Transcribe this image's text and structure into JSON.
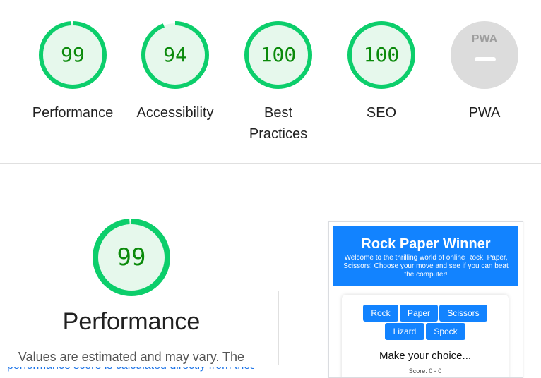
{
  "categories": [
    {
      "score": "99",
      "label": "Performance",
      "value": 99,
      "color": "#0cce6b"
    },
    {
      "score": "94",
      "label": "Accessibility",
      "value": 94,
      "color": "#0cce6b"
    },
    {
      "score": "100",
      "label": "Best Practices",
      "value": 100,
      "color": "#0cce6b"
    },
    {
      "score": "100",
      "label": "SEO",
      "value": 100,
      "color": "#0cce6b"
    },
    {
      "score": "PWA",
      "label": "PWA",
      "value": null,
      "color": "#dcdcdc"
    }
  ],
  "performance": {
    "score": "99",
    "value": 99,
    "title": "Performance",
    "description": "Values are estimated and may vary. The",
    "description_cut": "performance score is calculated directly from these metrics."
  },
  "screenshot": {
    "title": "Rock Paper Winner",
    "subtitle": "Welcome to the thrilling world of online Rock, Paper, Scissors! Choose your move and see if you can beat the computer!",
    "buttons": [
      "Rock",
      "Paper",
      "Scissors",
      "Lizard",
      "Spock"
    ],
    "prompt": "Make your choice...",
    "score_text": "Score: 0 - 0"
  }
}
